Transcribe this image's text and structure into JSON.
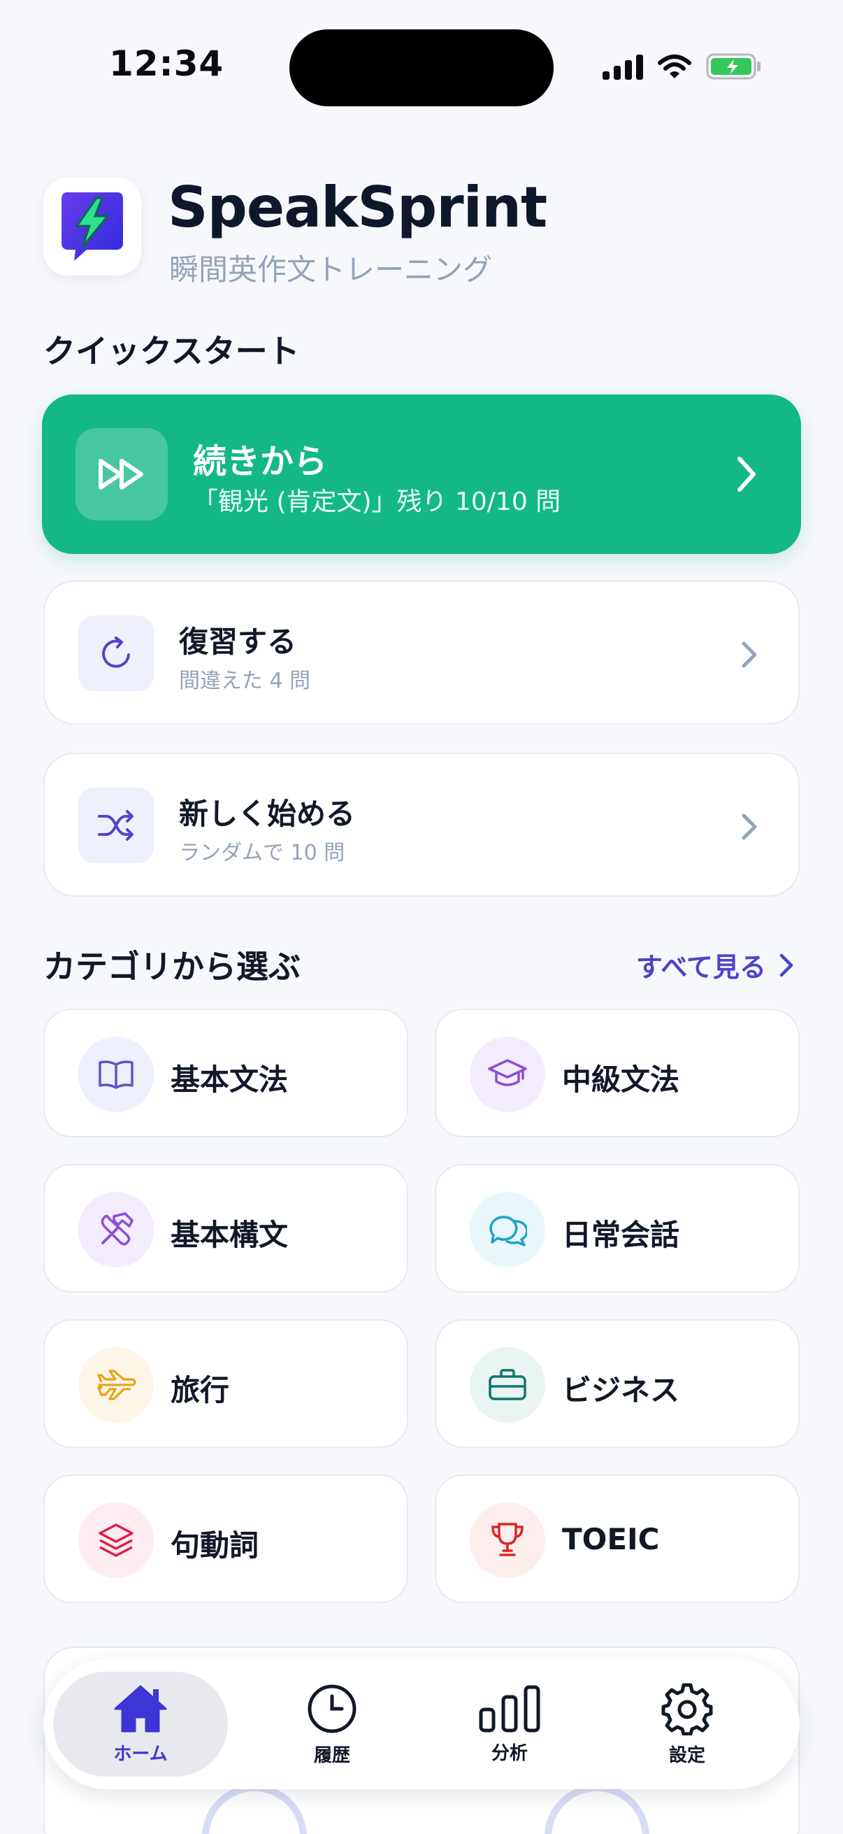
{
  "status": {
    "time": "12:34"
  },
  "header": {
    "app_name": "SpeakSprint",
    "subtitle": "瞬間英作文トレーニング"
  },
  "quick_start": {
    "title": "クイックスタート",
    "continue": {
      "title": "続きから",
      "subtitle": "「観光 (肯定文)」残り 10/10 問"
    },
    "review": {
      "title": "復習する",
      "subtitle": "間違えた 4 問"
    },
    "new": {
      "title": "新しく始める",
      "subtitle": "ランダムで 10 問"
    }
  },
  "categories": {
    "title": "カテゴリから選ぶ",
    "see_all": "すべて見る",
    "items": [
      {
        "label": "基本文法",
        "icon": "book-icon",
        "color": "#5b56c7",
        "bg": "#eef0fb"
      },
      {
        "label": "中級文法",
        "icon": "graduation-cap-icon",
        "color": "#8b4fd6",
        "bg": "#f3ecfc"
      },
      {
        "label": "基本構文",
        "icon": "tools-icon",
        "color": "#8b4fd6",
        "bg": "#f3ecfc"
      },
      {
        "label": "日常会話",
        "icon": "chat-bubbles-icon",
        "color": "#1aa3c8",
        "bg": "#e9f7fb"
      },
      {
        "label": "旅行",
        "icon": "airplane-icon",
        "color": "#e8a317",
        "bg": "#fdf6e8"
      },
      {
        "label": "ビジネス",
        "icon": "briefcase-icon",
        "color": "#0f766e",
        "bg": "#e9f5f2"
      },
      {
        "label": "句動詞",
        "icon": "layers-icon",
        "color": "#e11d48",
        "bg": "#fdedf0"
      },
      {
        "label": "TOEIC",
        "icon": "trophy-icon",
        "color": "#dc2626",
        "bg": "#fdeeee"
      }
    ]
  },
  "tabs": [
    {
      "label": "ホーム",
      "icon": "home-icon",
      "active": true
    },
    {
      "label": "履歴",
      "icon": "clock-icon",
      "active": false
    },
    {
      "label": "分析",
      "icon": "bar-chart-icon",
      "active": false
    },
    {
      "label": "設定",
      "icon": "gear-icon",
      "active": false
    }
  ],
  "colors": {
    "accent": "#14b886",
    "brand": "#3d35d6",
    "link": "#4b44c9"
  }
}
